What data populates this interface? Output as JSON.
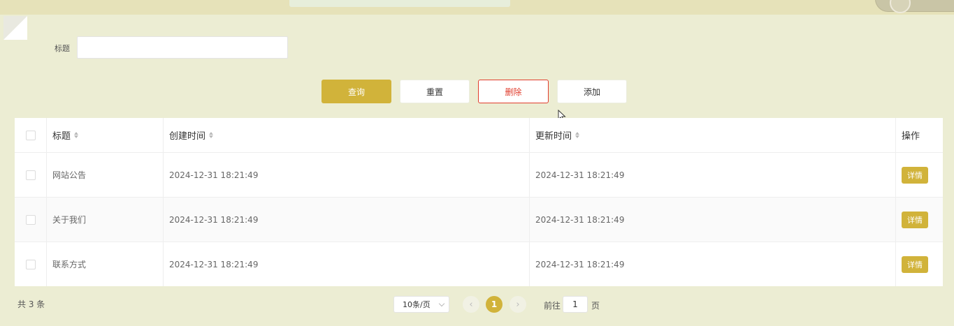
{
  "search": {
    "label": "标题",
    "value": ""
  },
  "toolbar": {
    "query_label": "查询",
    "reset_label": "重置",
    "delete_label": "删除",
    "add_label": "添加"
  },
  "table": {
    "headers": {
      "title": "标题",
      "created": "创建时间",
      "updated": "更新时间",
      "actions": "操作"
    },
    "rows": [
      {
        "title": "网站公告",
        "created": "2024-12-31 18:21:49",
        "updated": "2024-12-31 18:21:49",
        "action": "详情"
      },
      {
        "title": "关于我们",
        "created": "2024-12-31 18:21:49",
        "updated": "2024-12-31 18:21:49",
        "action": "详情"
      },
      {
        "title": "联系方式",
        "created": "2024-12-31 18:21:49",
        "updated": "2024-12-31 18:21:49",
        "action": "详情"
      }
    ]
  },
  "pagination": {
    "total_text": "共 3 条",
    "page_size": "10条/页",
    "current_page": "1",
    "goto_prefix": "前往",
    "goto_value": "1",
    "goto_suffix": "页",
    "prev_icon": "‹",
    "next_icon": "›"
  },
  "colors": {
    "accent": "#d1b33a",
    "danger": "#e03c2c",
    "background": "#ecedd3"
  }
}
